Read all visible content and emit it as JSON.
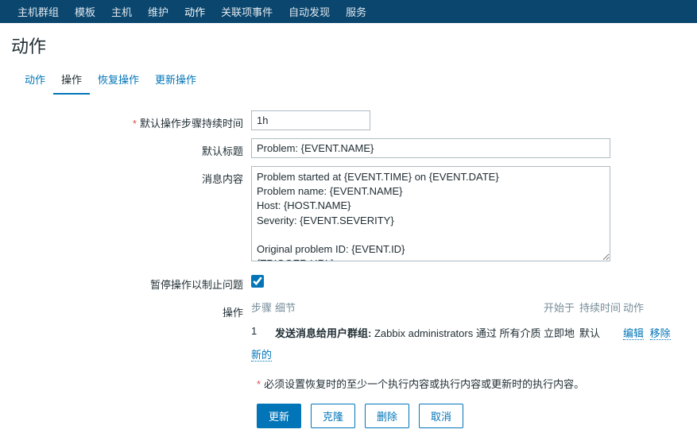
{
  "topnav": {
    "items": [
      "主机群组",
      "模板",
      "主机",
      "维护",
      "动作",
      "关联项事件",
      "自动发现",
      "服务"
    ],
    "activeIndex": 4
  },
  "pageTitle": "动作",
  "tabs": {
    "items": [
      "动作",
      "操作",
      "恢复操作",
      "更新操作"
    ],
    "activeIndex": 1
  },
  "form": {
    "durationLabel": "默认操作步骤持续时间",
    "durationValue": "1h",
    "subjectLabel": "默认标题",
    "subjectValue": "Problem: {EVENT.NAME}",
    "messageLabel": "消息内容",
    "messageValue": "Problem started at {EVENT.TIME} on {EVENT.DATE}\nProblem name: {EVENT.NAME}\nHost: {HOST.NAME}\nSeverity: {EVENT.SEVERITY}\n\nOriginal problem ID: {EVENT.ID}\n{TRIGGER.URL}",
    "pauseLabel": "暂停操作以制止问题",
    "pauseChecked": true,
    "opsLabel": "操作",
    "opsHeader": {
      "step": "步骤",
      "detail": "细节",
      "start": "开始于",
      "duration": "持续时间",
      "action": "动作"
    },
    "opsRow": {
      "step": "1",
      "detailBold": "发送消息给用户群组:",
      "detailRest": " Zabbix administrators 通过 所有介质",
      "start": "立即地",
      "duration": "默认",
      "edit": "编辑",
      "remove": "移除"
    },
    "newLabel": "新的",
    "note": "必须设置恢复时的至少一个执行内容或执行内容或更新时的执行内容。"
  },
  "buttons": {
    "update": "更新",
    "clone": "克隆",
    "delete": "删除",
    "cancel": "取消"
  }
}
